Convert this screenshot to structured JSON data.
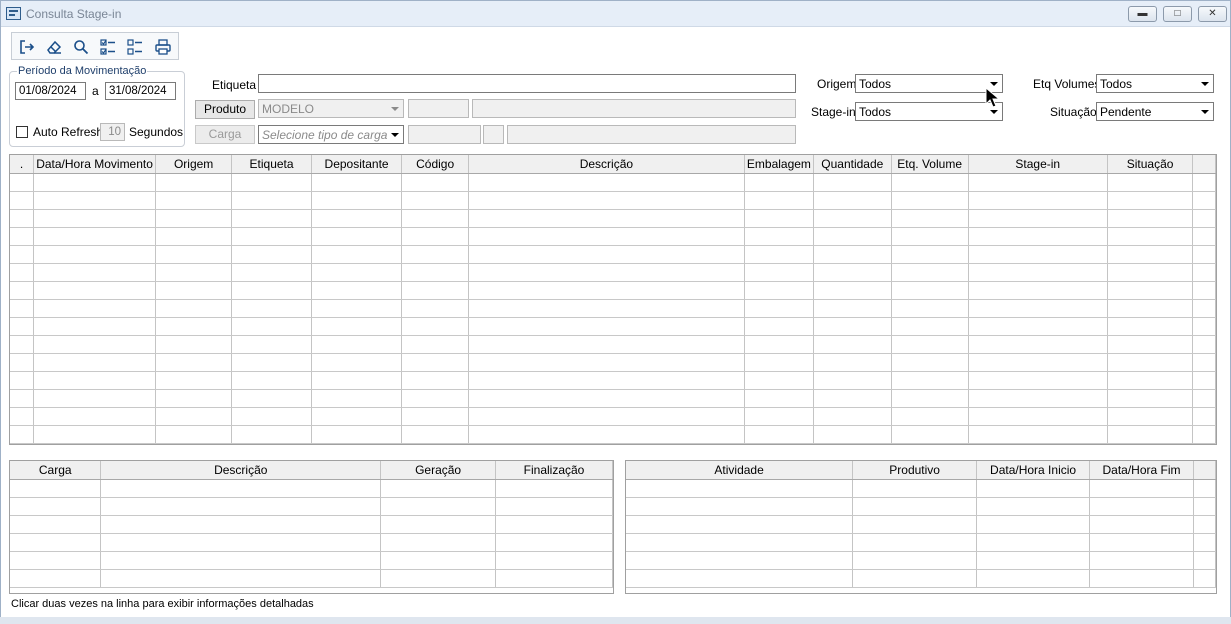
{
  "window": {
    "title": "Consulta Stage-in"
  },
  "toolbar": {
    "buttons": [
      {
        "name": "exit-icon"
      },
      {
        "name": "eraser-icon"
      },
      {
        "name": "search-icon"
      },
      {
        "name": "check-all-icon"
      },
      {
        "name": "uncheck-all-icon"
      },
      {
        "name": "print-icon"
      }
    ]
  },
  "periodo": {
    "legend": "Período da Movimentação",
    "start": "01/08/2024",
    "separator": "a",
    "end": "31/08/2024",
    "auto_refresh_label": "Auto Refresh",
    "auto_refresh_value": "10",
    "seconds_label": "Segundos"
  },
  "filters": {
    "etiqueta_label": "Etiqueta",
    "etiqueta_value": "",
    "produto_button": "Produto",
    "produto_value": "MODELO",
    "carga_button": "Carga",
    "carga_placeholder": "Selecione tipo de carga",
    "origem_label": "Origem",
    "origem_value": "Todos",
    "stagein_label": "Stage-in",
    "stagein_value": "Todos",
    "etq_volumes_label": "Etq Volumes",
    "etq_volumes_value": "Todos",
    "situacao_label": "Situação",
    "situacao_value": "Pendente"
  },
  "main_grid": {
    "columns": [
      ".",
      "Data/Hora Movimento",
      "Origem",
      "Etiqueta",
      "Depositante",
      "Código",
      "Descrição",
      "Embalagem",
      "Quantidade",
      "Etq. Volume",
      "Stage-in",
      "Situação"
    ]
  },
  "carga_grid": {
    "columns": [
      "Carga",
      "Descrição",
      "Geração",
      "Finalização"
    ]
  },
  "atividade_grid": {
    "columns": [
      "Atividade",
      "Produtivo",
      "Data/Hora Inicio",
      "Data/Hora Fim"
    ]
  },
  "status": {
    "text": "Clicar duas vezes na linha para exibir informações detalhadas"
  }
}
